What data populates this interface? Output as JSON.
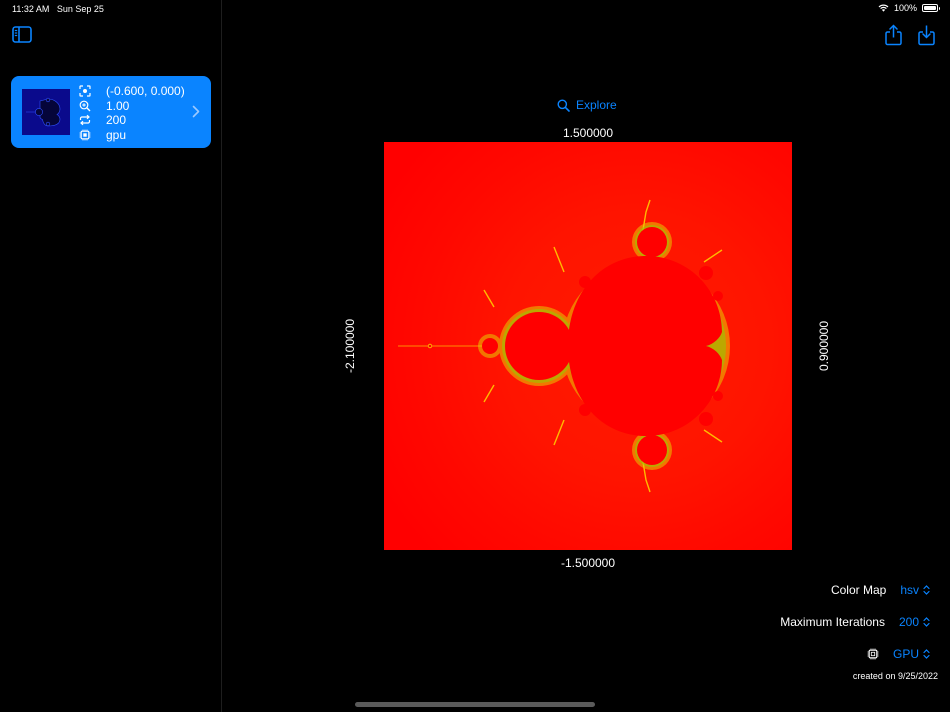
{
  "status_bar": {
    "time": "11:32 AM",
    "date": "Sun Sep 25",
    "battery": "100%"
  },
  "sidebar": {
    "items": [
      {
        "center": "(-0.600, 0.000)",
        "zoom": "1.00",
        "iterations": "200",
        "device": "gpu"
      }
    ]
  },
  "main": {
    "explore_label": "Explore",
    "axis": {
      "top": "1.500000",
      "bottom": "-1.500000",
      "left": "-2.100000",
      "right": "0.900000"
    },
    "controls": {
      "color_map_label": "Color Map",
      "color_map_value": "hsv",
      "max_iter_label": "Maximum Iterations",
      "max_iter_value": "200",
      "device_value": "GPU"
    },
    "created": "created on 9/25/2022"
  },
  "colors": {
    "accent": "#0a84ff",
    "background": "#000000",
    "fractal_base": "#ff0000"
  }
}
